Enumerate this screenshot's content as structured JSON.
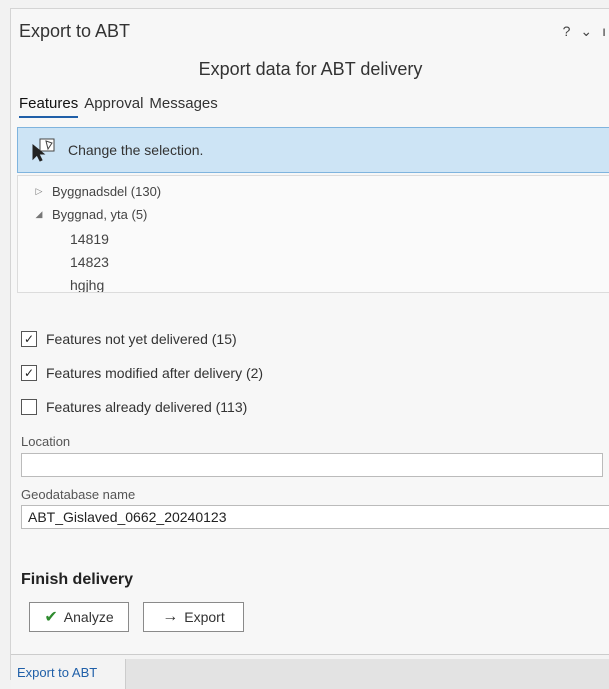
{
  "window": {
    "title": "Export to ABT",
    "help_glyph": "?",
    "menu_glyph": "⌄",
    "pin_glyph": "ı"
  },
  "heading": "Export data for ABT delivery",
  "tabs": [
    {
      "label": "Features",
      "active": true
    },
    {
      "label": "Approval",
      "active": false
    },
    {
      "label": "Messages",
      "active": false
    }
  ],
  "banner": {
    "icon": "selection-pointer-icon",
    "text": "Change the selection."
  },
  "tree": {
    "nodes": [
      {
        "label": "Byggnadsdel (130)",
        "expanded": false,
        "children": []
      },
      {
        "label": "Byggnad, yta (5)",
        "expanded": true,
        "children": [
          "14819",
          "14823",
          "hgjhg"
        ]
      }
    ]
  },
  "filters": [
    {
      "label": "Features not yet delivered (15)",
      "checked": true
    },
    {
      "label": "Features modified after delivery (2)",
      "checked": true
    },
    {
      "label": "Features already delivered (113)",
      "checked": false
    }
  ],
  "location": {
    "label": "Location",
    "value": ""
  },
  "geodatabase": {
    "label": "Geodatabase name",
    "value": "ABT_Gislaved_0662_20240123"
  },
  "finish": {
    "title": "Finish delivery",
    "analyze_label": "Analyze",
    "export_label": "Export"
  },
  "footer": {
    "tab_label": "Export to ABT"
  },
  "colors": {
    "accent": "#1f5fa8",
    "banner_bg": "#cde4f5",
    "check_green": "#2e8b2e"
  }
}
